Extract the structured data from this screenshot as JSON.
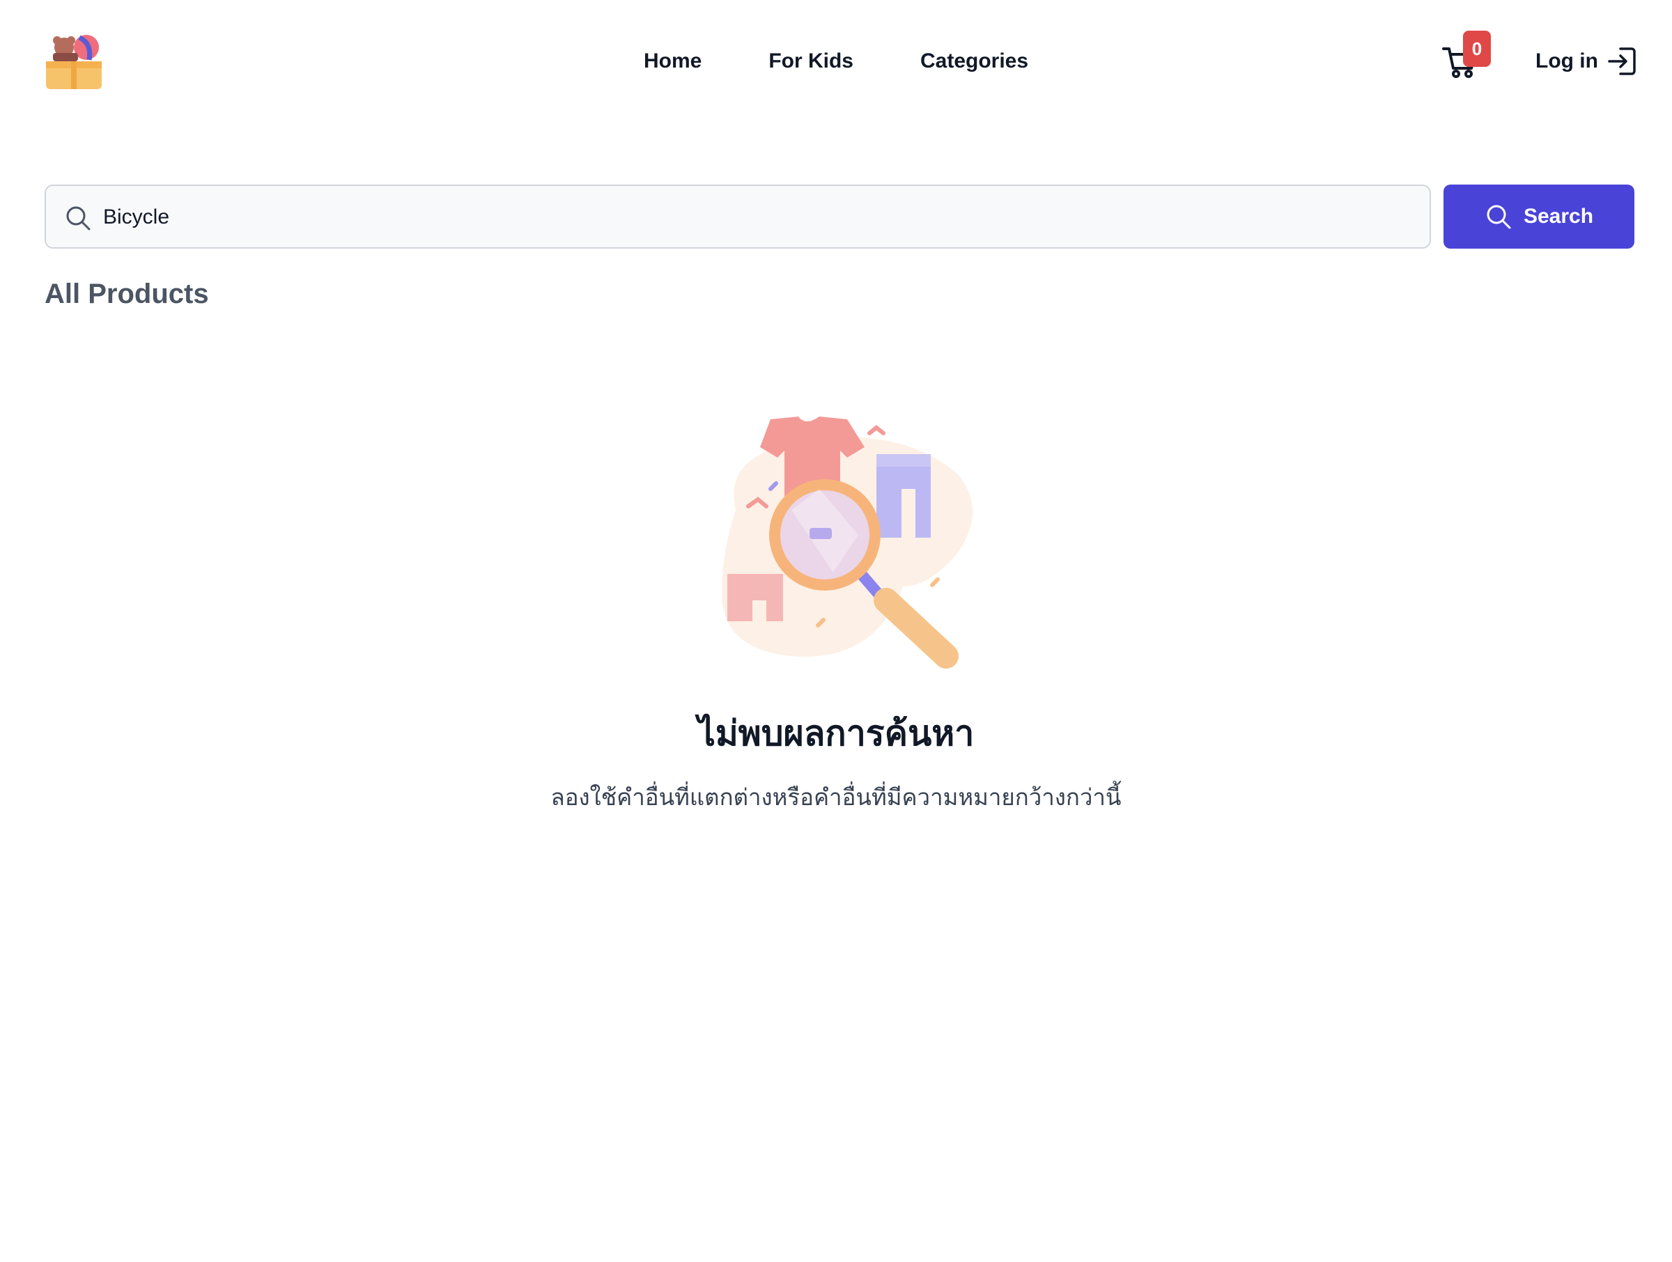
{
  "header": {
    "nav": [
      "Home",
      "For Kids",
      "Categories"
    ],
    "cart_count": "0",
    "login_label": "Log in"
  },
  "search": {
    "value": "Bicycle",
    "button_label": "Search"
  },
  "main": {
    "section_title": "All Products",
    "empty_title": "ไม่พบผลการค้นหา",
    "empty_text": "ลองใช้คำอื่นที่แตกต่างหรือคำอื่นที่มีความหมายกว้างกว่านี้"
  },
  "colors": {
    "primary": "#4a43d8",
    "badge": "#e04848",
    "text": "#111827",
    "muted": "#4b5563"
  },
  "icons": [
    "logo-icon",
    "cart-icon",
    "login-icon",
    "search-icon"
  ]
}
